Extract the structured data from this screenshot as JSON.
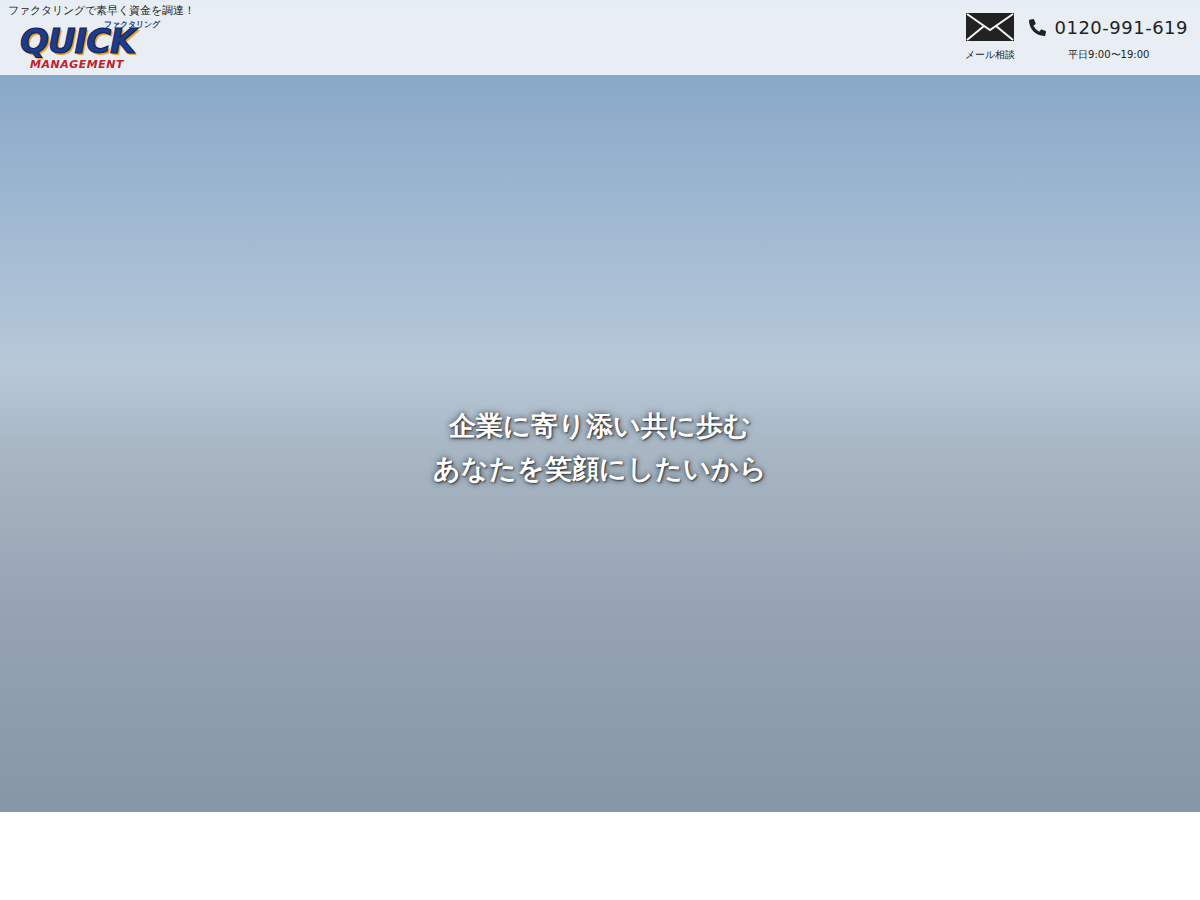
{
  "header": {
    "tagline": "ファクタリングで素早く資金を調達！",
    "logo": {
      "main": "QUICK",
      "sub": "ファクタリング",
      "bottom": "MANAGEMENT"
    },
    "mail": {
      "label": "メール相談"
    },
    "phone": {
      "number": "0120-991-619",
      "hours": "平日9:00〜19:00"
    }
  },
  "hero": {
    "lines": [
      "企業に寄り添い共に歩む",
      "あなたを笑顔にしたいから"
    ]
  }
}
